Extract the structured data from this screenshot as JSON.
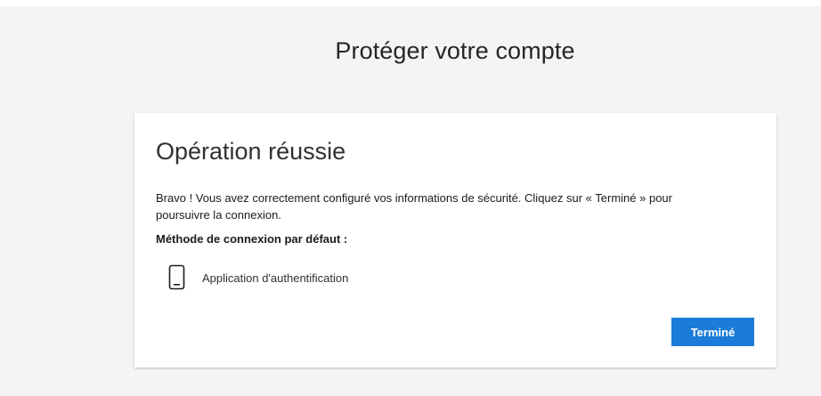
{
  "page": {
    "title": "Protéger votre compte"
  },
  "card": {
    "heading": "Opération réussie",
    "message": "Bravo ! Vous avez correctement configuré vos informations de sécurité. Cliquez sur « Terminé » pour poursuivre la connexion.",
    "default_method_label": "Méthode de connexion par défaut :",
    "default_method": {
      "icon": "phone-icon",
      "name": "Application d'authentification"
    },
    "done_button_label": "Terminé"
  },
  "colors": {
    "background": "#f4f4f4",
    "card": "#ffffff",
    "accent": "#1a7bd8",
    "text": "#1b1b1b"
  }
}
